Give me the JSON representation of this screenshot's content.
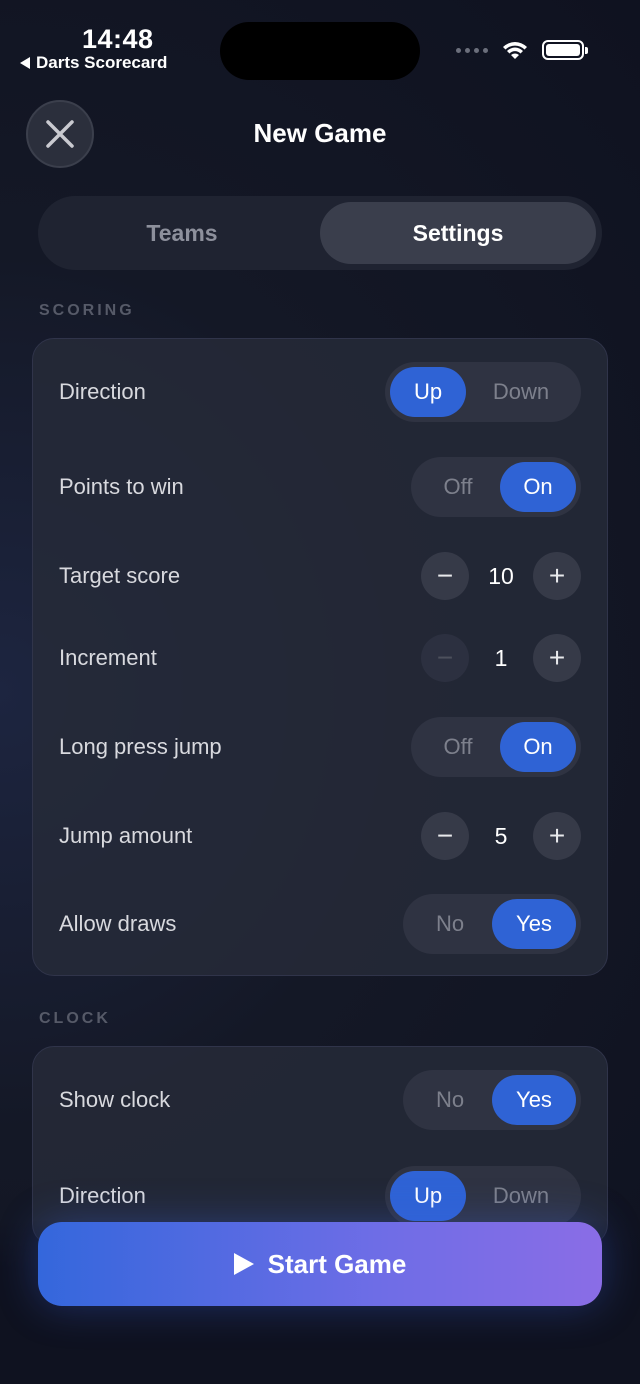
{
  "status_bar": {
    "time": "14:48",
    "back_app": "Darts Scorecard"
  },
  "header": {
    "title": "New Game",
    "close_icon": "close-x-icon"
  },
  "tabs": [
    {
      "label": "Teams",
      "active": false
    },
    {
      "label": "Settings",
      "active": true
    }
  ],
  "sections": {
    "scoring": {
      "label": "SCORING",
      "direction": {
        "label": "Direction",
        "options": [
          "Up",
          "Down"
        ],
        "selected": "Up"
      },
      "points_to_win": {
        "label": "Points to win",
        "options": [
          "Off",
          "On"
        ],
        "selected": "On"
      },
      "target_score": {
        "label": "Target score",
        "value": "10",
        "minus": "−",
        "plus": "+"
      },
      "increment": {
        "label": "Increment",
        "value": "1",
        "minus": "−",
        "plus": "+"
      },
      "long_press_jump": {
        "label": "Long press jump",
        "options": [
          "Off",
          "On"
        ],
        "selected": "On"
      },
      "jump_amount": {
        "label": "Jump amount",
        "value": "5",
        "minus": "−",
        "plus": "+"
      },
      "allow_draws": {
        "label": "Allow draws",
        "options": [
          "No",
          "Yes"
        ],
        "selected": "Yes"
      }
    },
    "clock": {
      "label": "CLOCK",
      "show_clock": {
        "label": "Show clock",
        "options": [
          "No",
          "Yes"
        ],
        "selected": "Yes"
      },
      "direction": {
        "label": "Direction",
        "options": [
          "Up",
          "Down"
        ],
        "selected": "Up"
      }
    }
  },
  "start_button": {
    "label": "Start Game",
    "icon": "play-icon"
  },
  "colors": {
    "accent": "#2f63d5",
    "background": "#141826",
    "card": "#262a38",
    "gradient_end": "#8a6de6"
  }
}
